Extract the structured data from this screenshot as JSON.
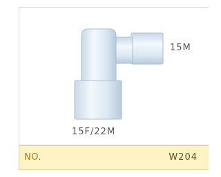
{
  "diagram": {
    "label_side": "15M",
    "label_bottom": "15F/22M"
  },
  "footer": {
    "no_label": "NO.",
    "part_code": "W204"
  },
  "colors": {
    "panel_border": "#d8d8d8",
    "footer_bg": "#fdf3c4",
    "fitting_fill": "#dbe8f3",
    "fitting_edge": "#9fb6c8"
  }
}
